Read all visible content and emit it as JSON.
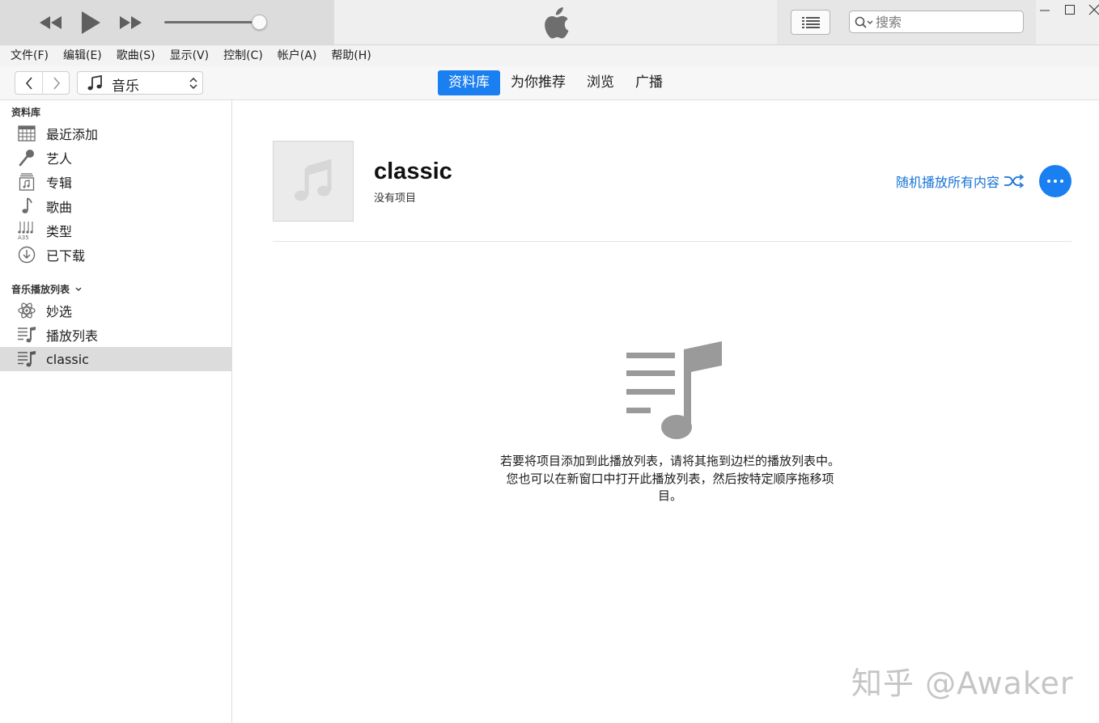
{
  "search": {
    "placeholder": "搜索"
  },
  "menu": [
    "文件(F)",
    "编辑(E)",
    "歌曲(S)",
    "显示(V)",
    "控制(C)",
    "帐户(A)",
    "帮助(H)"
  ],
  "media_selector": {
    "label": "音乐",
    "icon": "music-note-icon"
  },
  "tabs": [
    {
      "label": "资料库",
      "active": true
    },
    {
      "label": "为你推荐",
      "active": false
    },
    {
      "label": "浏览",
      "active": false
    },
    {
      "label": "广播",
      "active": false
    }
  ],
  "sidebar": {
    "library_heading": "资料库",
    "library": [
      {
        "label": "最近添加",
        "icon": "calendar-grid-icon"
      },
      {
        "label": "艺人",
        "icon": "microphone-icon"
      },
      {
        "label": "专辑",
        "icon": "album-icon"
      },
      {
        "label": "歌曲",
        "icon": "music-note-icon"
      },
      {
        "label": "类型",
        "icon": "genre-icon"
      },
      {
        "label": "已下载",
        "icon": "download-circle-icon"
      }
    ],
    "playlists_heading": "音乐播放列表",
    "playlists": [
      {
        "label": "妙选",
        "icon": "atom-icon"
      },
      {
        "label": "播放列表",
        "icon": "playlist-icon"
      },
      {
        "label": "classic",
        "icon": "playlist-icon",
        "selected": true
      }
    ]
  },
  "playlist": {
    "title": "classic",
    "subtitle": "没有项目",
    "shuffle_label": "随机播放所有内容"
  },
  "empty_message": "若要将项目添加到此播放列表，请将其拖到边栏的播放列表中。您也可以在新窗口中打开此播放列表，然后按特定顺序拖移项目。",
  "watermark": "知乎 @Awaker",
  "colors": {
    "accent": "#1a7ff0",
    "link": "#1773d6",
    "selected_row": "#dcdcdc"
  }
}
